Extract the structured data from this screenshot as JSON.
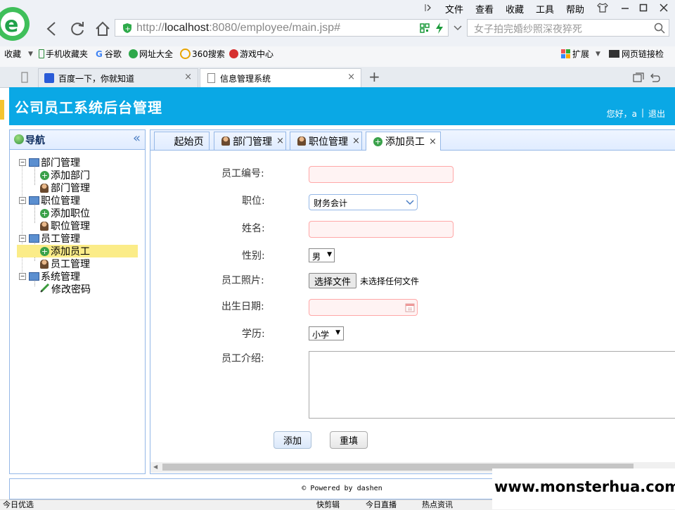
{
  "browser": {
    "address": {
      "prefix": "http://",
      "host": "localhost",
      "rest": ":8080/employee/main.jsp#"
    },
    "search_placeholder": "女子拍完婚纱照深夜猝死",
    "menu": [
      "文件",
      "查看",
      "收藏",
      "工具",
      "帮助"
    ],
    "bookmarks": [
      "收藏",
      "手机收藏夹",
      "谷歌",
      "网址大全",
      "360搜索",
      "游戏中心"
    ],
    "bookmarks_right": [
      "扩展",
      "网页链接检"
    ],
    "tabs": [
      {
        "label": "百度一下，你就知道"
      },
      {
        "label": "信息管理系统"
      }
    ],
    "new_tab": "+"
  },
  "app": {
    "title": "公司员工系统后台管理",
    "greeting": "您好，a",
    "logout": "退出",
    "nav": {
      "title": "导航",
      "collapse": "«",
      "groups": [
        {
          "label": "部门管理",
          "items": [
            "添加部门",
            "部门管理"
          ]
        },
        {
          "label": "职位管理",
          "items": [
            "添加职位",
            "职位管理"
          ]
        },
        {
          "label": "员工管理",
          "items": [
            "添加员工",
            "员工管理"
          ]
        },
        {
          "label": "系统管理",
          "items": [
            "修改密码"
          ]
        }
      ]
    },
    "tabs": [
      "起始页",
      "部门管理",
      "职位管理",
      "添加员工"
    ],
    "form": {
      "labels": {
        "emp_no": "员工编号:",
        "position": "职位:",
        "name": "姓名:",
        "gender": "性别:",
        "photo": "员工照片:",
        "birthday": "出生日期:",
        "education": "学历:",
        "intro": "员工介绍:"
      },
      "position_value": "财务会计",
      "gender_value": "男",
      "file_button": "选择文件",
      "file_status": "未选择任何文件",
      "education_value": "小学",
      "add_button": "添加",
      "reset_button": "重填"
    },
    "footer": "© Powered by dashen"
  },
  "status_bar": {
    "left": "今日优选",
    "items": [
      "快剪辑",
      "今日直播",
      "热点资讯"
    ]
  },
  "watermark": "www.monsterhua.com"
}
